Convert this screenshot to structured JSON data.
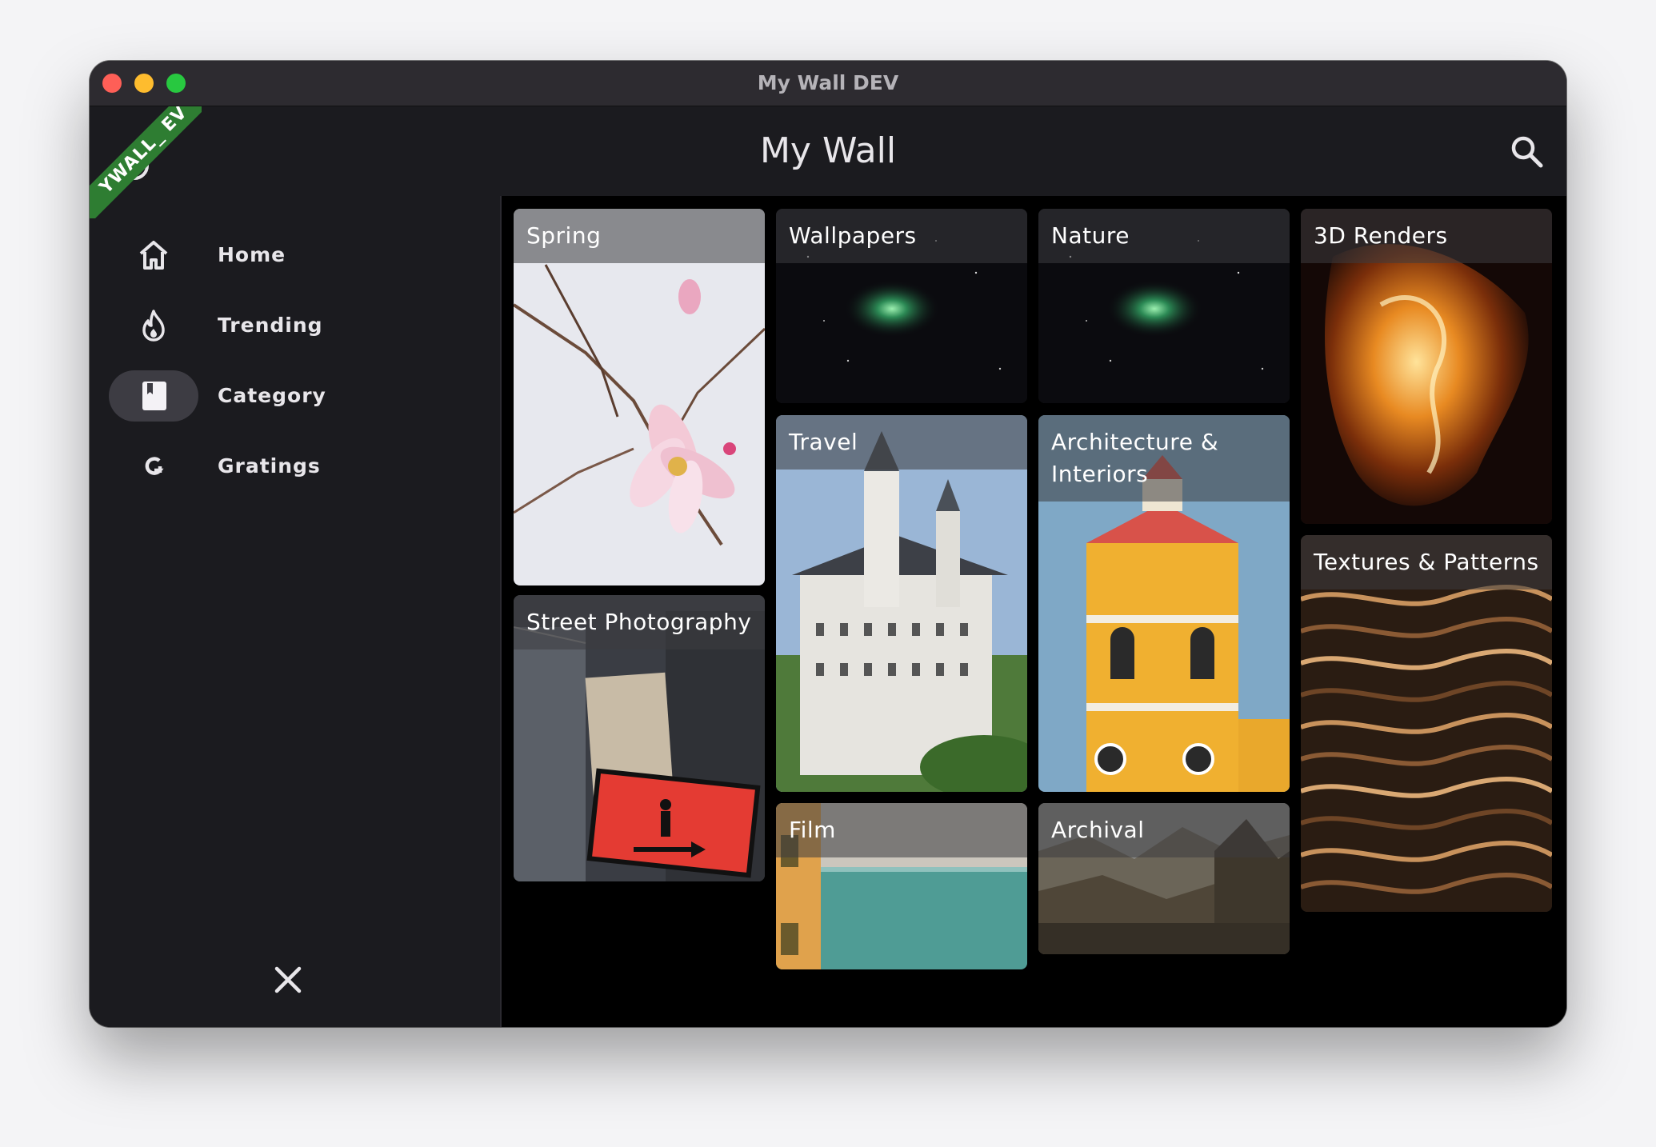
{
  "window": {
    "title": "My Wall DEV"
  },
  "appbar": {
    "title": "My Wall",
    "search_icon": "search-icon"
  },
  "debug_ribbon": {
    "text": "YWALL_ EV",
    "color": "#2e7d32"
  },
  "sidebar": {
    "items": [
      {
        "label": "Home",
        "icon": "home-icon",
        "active": false
      },
      {
        "label": "Trending",
        "icon": "flame-icon",
        "active": false
      },
      {
        "label": "Category",
        "icon": "bookmark-book-icon",
        "active": true
      },
      {
        "label": "Gratings",
        "icon": "g-letter-icon",
        "active": false
      }
    ],
    "close_icon": "close-icon"
  },
  "categories": [
    {
      "label": "Spring"
    },
    {
      "label": "Street Photography"
    },
    {
      "label": "Wallpapers"
    },
    {
      "label": "Travel"
    },
    {
      "label": "Film"
    },
    {
      "label": "Nature"
    },
    {
      "label": "Architecture & Interiors"
    },
    {
      "label": "Archival"
    },
    {
      "label": "3D Renders"
    },
    {
      "label": "Textures & Patterns"
    }
  ],
  "colors": {
    "surface": "#1b1b1f",
    "active_pill": "#3d3c43",
    "content_bg": "#000000",
    "traffic_red": "#fe5f57",
    "traffic_yellow": "#febc2e",
    "traffic_green": "#28c840"
  }
}
